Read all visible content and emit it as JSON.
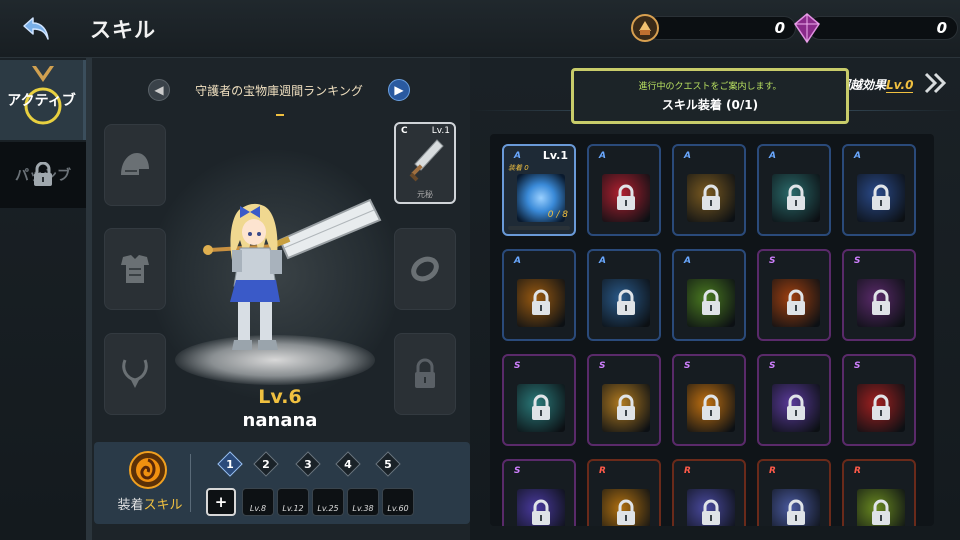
{
  "header": {
    "title": "スキル",
    "gold_amount": "0",
    "gem_amount": "0"
  },
  "tabs": {
    "active_label": "アクティブ",
    "passive_label": "パッシブ"
  },
  "ranking": {
    "label": "守護者の宝物庫週間ランキング"
  },
  "character": {
    "level": "Lv.6",
    "name": "nanana",
    "weapon": {
      "rank": "C",
      "level": "Lv.1",
      "tag": "元秘"
    }
  },
  "equipped_skills": {
    "label_prefix": "装着",
    "label_highlight": "スキル",
    "plus_label": "+",
    "numbers": [
      "1",
      "2",
      "3",
      "4",
      "5"
    ],
    "lock_levels": [
      "Lv.8",
      "Lv.12",
      "Lv.25",
      "Lv.38",
      "Lv.60"
    ]
  },
  "quest": {
    "hint": "進行中のクエストをご案内します。",
    "title": "スキル装着 (0/1)"
  },
  "transcend": {
    "label": "スキル超越効果",
    "level": "Lv.0"
  },
  "skill_grid": [
    {
      "grade": "A",
      "level": "Lv.1",
      "equip_tag": "装着 0",
      "count": "0 / 8",
      "locked": false,
      "color": "#3a8ad8",
      "border": "#6a9ad8"
    },
    {
      "grade": "A",
      "locked": true,
      "color": "#b02030",
      "border": "#2a4a7a"
    },
    {
      "grade": "A",
      "locked": true,
      "color": "#7a5a20",
      "border": "#2a4a7a"
    },
    {
      "grade": "A",
      "locked": true,
      "color": "#2a6a6a",
      "border": "#2a4a7a"
    },
    {
      "grade": "A",
      "locked": true,
      "color": "#2a4a8a",
      "border": "#2a4a7a"
    },
    {
      "grade": "A",
      "locked": true,
      "color": "#9a5a10",
      "border": "#2a4a7a"
    },
    {
      "grade": "A",
      "locked": true,
      "color": "#2a5a8a",
      "border": "#2a4a7a"
    },
    {
      "grade": "A",
      "locked": true,
      "color": "#4a7a20",
      "border": "#2a4a7a"
    },
    {
      "grade": "S",
      "locked": true,
      "color": "#a04010",
      "border": "#5a2a6a"
    },
    {
      "grade": "S",
      "locked": true,
      "color": "#5a2a6a",
      "border": "#5a2a6a"
    },
    {
      "grade": "S",
      "locked": true,
      "color": "#2a7a7a",
      "border": "#5a2a6a"
    },
    {
      "grade": "S",
      "locked": true,
      "color": "#b07a20",
      "border": "#5a2a6a"
    },
    {
      "grade": "S",
      "locked": true,
      "color": "#c07010",
      "border": "#5a2a6a"
    },
    {
      "grade": "S",
      "locked": true,
      "color": "#5a3a9a",
      "border": "#5a2a6a"
    },
    {
      "grade": "S",
      "locked": true,
      "color": "#a02020",
      "border": "#5a2a6a"
    },
    {
      "grade": "S",
      "locked": true,
      "color": "#4a3aa0",
      "border": "#5a2a6a"
    },
    {
      "grade": "R",
      "locked": true,
      "color": "#b07010",
      "border": "#6a2a1a"
    },
    {
      "grade": "R",
      "locked": true,
      "color": "#4a4aa0",
      "border": "#6a2a1a"
    },
    {
      "grade": "R",
      "locked": true,
      "color": "#4a5aa0",
      "border": "#6a2a1a"
    },
    {
      "grade": "R",
      "locked": true,
      "color": "#6a8a20",
      "border": "#6a2a1a"
    }
  ],
  "colors": {
    "accent_gold": "#f0c040",
    "quest_border": "#c8cc6a",
    "grade_a": "#6aa8ff",
    "grade_s": "#d080ff",
    "grade_r": "#ff5a4a"
  }
}
